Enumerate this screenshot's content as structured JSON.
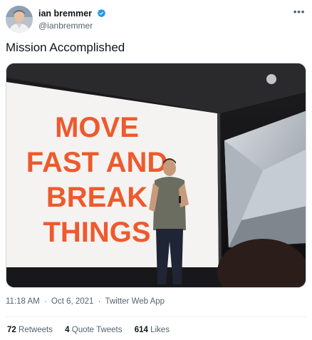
{
  "author": {
    "display_name": "ian bremmer",
    "handle": "@ianbremmer",
    "verified": true,
    "verified_color": "#1d9bf0"
  },
  "more_icon": "•••",
  "tweet": {
    "text": "Mission Accomplished",
    "image_slogan": [
      "MOVE",
      "FAST AND",
      "BREAK",
      "THINGS"
    ],
    "slogan_color": "#ee5a2d"
  },
  "meta": {
    "time": "11:18 AM",
    "date": "Oct 6, 2021",
    "source": "Twitter Web App",
    "separator": "·"
  },
  "stats": {
    "retweets_count": "72",
    "retweets_label": "Retweets",
    "quotes_count": "4",
    "quotes_label": "Quote Tweets",
    "likes_count": "614",
    "likes_label": "Likes"
  }
}
